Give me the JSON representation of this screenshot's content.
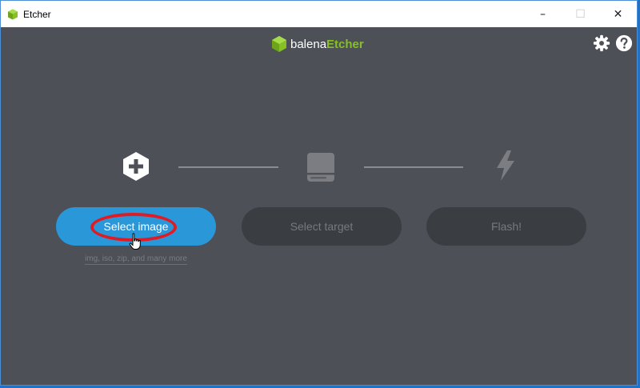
{
  "window": {
    "title": "Etcher",
    "controls": {
      "minimize": "–",
      "maximize": "☐",
      "close": "✕"
    }
  },
  "header": {
    "logo_part1": "balena",
    "logo_part2": "Etcher",
    "settings_icon": "gear-icon",
    "help_icon": "help-icon"
  },
  "steps": [
    {
      "icon": "plus-hexagon-icon",
      "button_label": "Select image",
      "hint": "img, iso, zip, and many more",
      "state": "active"
    },
    {
      "icon": "drive-icon",
      "button_label": "Select target",
      "state": "disabled"
    },
    {
      "icon": "lightning-icon",
      "button_label": "Flash!",
      "state": "disabled"
    }
  ],
  "colors": {
    "background": "#4d5057",
    "primary_button": "#2a97d8",
    "disabled_button": "#3a3d42",
    "logo_green": "#85c125",
    "highlight_annotation": "#e01b24"
  }
}
